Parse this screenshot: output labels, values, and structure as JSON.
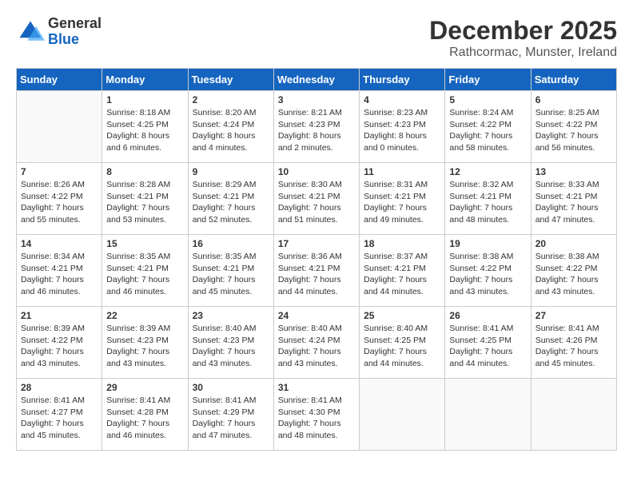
{
  "header": {
    "logo_general": "General",
    "logo_blue": "Blue",
    "month_title": "December 2025",
    "location": "Rathcormac, Munster, Ireland"
  },
  "days_of_week": [
    "Sunday",
    "Monday",
    "Tuesday",
    "Wednesday",
    "Thursday",
    "Friday",
    "Saturday"
  ],
  "weeks": [
    [
      {
        "day": "",
        "content": ""
      },
      {
        "day": "1",
        "content": "Sunrise: 8:18 AM\nSunset: 4:25 PM\nDaylight: 8 hours\nand 6 minutes."
      },
      {
        "day": "2",
        "content": "Sunrise: 8:20 AM\nSunset: 4:24 PM\nDaylight: 8 hours\nand 4 minutes."
      },
      {
        "day": "3",
        "content": "Sunrise: 8:21 AM\nSunset: 4:23 PM\nDaylight: 8 hours\nand 2 minutes."
      },
      {
        "day": "4",
        "content": "Sunrise: 8:23 AM\nSunset: 4:23 PM\nDaylight: 8 hours\nand 0 minutes."
      },
      {
        "day": "5",
        "content": "Sunrise: 8:24 AM\nSunset: 4:22 PM\nDaylight: 7 hours\nand 58 minutes."
      },
      {
        "day": "6",
        "content": "Sunrise: 8:25 AM\nSunset: 4:22 PM\nDaylight: 7 hours\nand 56 minutes."
      }
    ],
    [
      {
        "day": "7",
        "content": "Sunrise: 8:26 AM\nSunset: 4:22 PM\nDaylight: 7 hours\nand 55 minutes."
      },
      {
        "day": "8",
        "content": "Sunrise: 8:28 AM\nSunset: 4:21 PM\nDaylight: 7 hours\nand 53 minutes."
      },
      {
        "day": "9",
        "content": "Sunrise: 8:29 AM\nSunset: 4:21 PM\nDaylight: 7 hours\nand 52 minutes."
      },
      {
        "day": "10",
        "content": "Sunrise: 8:30 AM\nSunset: 4:21 PM\nDaylight: 7 hours\nand 51 minutes."
      },
      {
        "day": "11",
        "content": "Sunrise: 8:31 AM\nSunset: 4:21 PM\nDaylight: 7 hours\nand 49 minutes."
      },
      {
        "day": "12",
        "content": "Sunrise: 8:32 AM\nSunset: 4:21 PM\nDaylight: 7 hours\nand 48 minutes."
      },
      {
        "day": "13",
        "content": "Sunrise: 8:33 AM\nSunset: 4:21 PM\nDaylight: 7 hours\nand 47 minutes."
      }
    ],
    [
      {
        "day": "14",
        "content": "Sunrise: 8:34 AM\nSunset: 4:21 PM\nDaylight: 7 hours\nand 46 minutes."
      },
      {
        "day": "15",
        "content": "Sunrise: 8:35 AM\nSunset: 4:21 PM\nDaylight: 7 hours\nand 46 minutes."
      },
      {
        "day": "16",
        "content": "Sunrise: 8:35 AM\nSunset: 4:21 PM\nDaylight: 7 hours\nand 45 minutes."
      },
      {
        "day": "17",
        "content": "Sunrise: 8:36 AM\nSunset: 4:21 PM\nDaylight: 7 hours\nand 44 minutes."
      },
      {
        "day": "18",
        "content": "Sunrise: 8:37 AM\nSunset: 4:21 PM\nDaylight: 7 hours\nand 44 minutes."
      },
      {
        "day": "19",
        "content": "Sunrise: 8:38 AM\nSunset: 4:22 PM\nDaylight: 7 hours\nand 43 minutes."
      },
      {
        "day": "20",
        "content": "Sunrise: 8:38 AM\nSunset: 4:22 PM\nDaylight: 7 hours\nand 43 minutes."
      }
    ],
    [
      {
        "day": "21",
        "content": "Sunrise: 8:39 AM\nSunset: 4:22 PM\nDaylight: 7 hours\nand 43 minutes."
      },
      {
        "day": "22",
        "content": "Sunrise: 8:39 AM\nSunset: 4:23 PM\nDaylight: 7 hours\nand 43 minutes."
      },
      {
        "day": "23",
        "content": "Sunrise: 8:40 AM\nSunset: 4:23 PM\nDaylight: 7 hours\nand 43 minutes."
      },
      {
        "day": "24",
        "content": "Sunrise: 8:40 AM\nSunset: 4:24 PM\nDaylight: 7 hours\nand 43 minutes."
      },
      {
        "day": "25",
        "content": "Sunrise: 8:40 AM\nSunset: 4:25 PM\nDaylight: 7 hours\nand 44 minutes."
      },
      {
        "day": "26",
        "content": "Sunrise: 8:41 AM\nSunset: 4:25 PM\nDaylight: 7 hours\nand 44 minutes."
      },
      {
        "day": "27",
        "content": "Sunrise: 8:41 AM\nSunset: 4:26 PM\nDaylight: 7 hours\nand 45 minutes."
      }
    ],
    [
      {
        "day": "28",
        "content": "Sunrise: 8:41 AM\nSunset: 4:27 PM\nDaylight: 7 hours\nand 45 minutes."
      },
      {
        "day": "29",
        "content": "Sunrise: 8:41 AM\nSunset: 4:28 PM\nDaylight: 7 hours\nand 46 minutes."
      },
      {
        "day": "30",
        "content": "Sunrise: 8:41 AM\nSunset: 4:29 PM\nDaylight: 7 hours\nand 47 minutes."
      },
      {
        "day": "31",
        "content": "Sunrise: 8:41 AM\nSunset: 4:30 PM\nDaylight: 7 hours\nand 48 minutes."
      },
      {
        "day": "",
        "content": ""
      },
      {
        "day": "",
        "content": ""
      },
      {
        "day": "",
        "content": ""
      }
    ]
  ]
}
